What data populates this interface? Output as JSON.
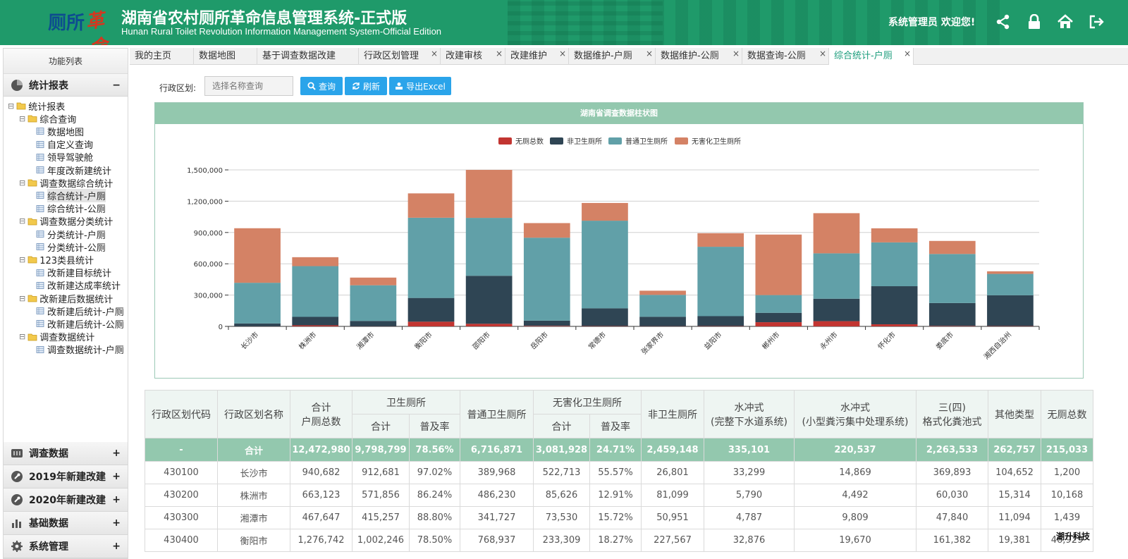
{
  "header": {
    "logo_text": "厕所",
    "logo_stylized": "革命",
    "title_cn": "湖南省农村厕所革命信息管理系统-正式版",
    "title_en": "Hunan Rural Toilet Revolution Information Management System-Official Edition",
    "welcome": "系统管理员 欢迎您!",
    "icons": [
      "share-icon",
      "lock-icon",
      "home-icon",
      "logout-icon"
    ]
  },
  "sidebar": {
    "title": "功能列表",
    "top_group": {
      "label": "统计报表",
      "sign": "−",
      "icon": "pie-chart-icon"
    },
    "tree": [
      {
        "label": "统计报表",
        "level": 0,
        "type": "folder",
        "toggle": "⊟"
      },
      {
        "label": "综合查询",
        "level": 1,
        "type": "folder",
        "toggle": "⊟"
      },
      {
        "label": "数据地图",
        "level": 2,
        "type": "page"
      },
      {
        "label": "自定义查询",
        "level": 2,
        "type": "page"
      },
      {
        "label": "领导驾驶舱",
        "level": 2,
        "type": "page"
      },
      {
        "label": "年度改新建统计",
        "level": 2,
        "type": "page"
      },
      {
        "label": "调查数据综合统计",
        "level": 1,
        "type": "folder",
        "toggle": "⊟"
      },
      {
        "label": "综合统计-户厕",
        "level": 2,
        "type": "page",
        "selected": true
      },
      {
        "label": "综合统计-公厕",
        "level": 2,
        "type": "page"
      },
      {
        "label": "调查数据分类统计",
        "level": 1,
        "type": "folder",
        "toggle": "⊟"
      },
      {
        "label": "分类统计-户厕",
        "level": 2,
        "type": "page"
      },
      {
        "label": "分类统计-公厕",
        "level": 2,
        "type": "page"
      },
      {
        "label": "123类县统计",
        "level": 1,
        "type": "folder",
        "toggle": "⊟"
      },
      {
        "label": "改新建目标统计",
        "level": 2,
        "type": "page"
      },
      {
        "label": "改新建达成率统计",
        "level": 2,
        "type": "page"
      },
      {
        "label": "改新建后数据统计",
        "level": 1,
        "type": "folder",
        "toggle": "⊟"
      },
      {
        "label": "改新建后统计-户厕",
        "level": 2,
        "type": "page"
      },
      {
        "label": "改新建后统计-公厕",
        "level": 2,
        "type": "page"
      },
      {
        "label": "调查数据统计",
        "level": 1,
        "type": "folder",
        "toggle": "⊟"
      },
      {
        "label": "调查数据统计-户厕",
        "level": 2,
        "type": "page"
      }
    ],
    "bottom_groups": [
      {
        "label": "调查数据",
        "sign": "+",
        "icon": "survey-icon"
      },
      {
        "label": "2019年新建改建",
        "sign": "+",
        "icon": "wrench-icon"
      },
      {
        "label": "2020年新建改建",
        "sign": "+",
        "icon": "wrench-icon"
      },
      {
        "label": "基础数据",
        "sign": "+",
        "icon": "bar-chart-icon"
      },
      {
        "label": "系统管理",
        "sign": "+",
        "icon": "gear-icon"
      }
    ]
  },
  "tabs": [
    {
      "label": "我的主页",
      "closable": false
    },
    {
      "label": "数据地图",
      "closable": false
    },
    {
      "label": "基于调查数据改建",
      "closable": false
    },
    {
      "label": "行政区划管理",
      "closable": true
    },
    {
      "label": "改建审核",
      "closable": true
    },
    {
      "label": "改建维护",
      "closable": true
    },
    {
      "label": "数据维护-户厕",
      "closable": true
    },
    {
      "label": "数据维护-公厕",
      "closable": true
    },
    {
      "label": "数据查询-公厕",
      "closable": true
    },
    {
      "label": "综合统计-户厕",
      "closable": true,
      "active": true
    }
  ],
  "search": {
    "label": "行政区划:",
    "placeholder": "选择名称查询",
    "query_label": "查询",
    "refresh_label": "刷新",
    "export_label": "导出Excel"
  },
  "chart_data": {
    "type": "bar",
    "stacked": true,
    "title": "湖南省调查数据柱状图",
    "legend_position": "top-center",
    "categories": [
      "长沙市",
      "株洲市",
      "湘潭市",
      "衡阳市",
      "邵阳市",
      "岳阳市",
      "常德市",
      "张家界市",
      "益阳市",
      "郴州市",
      "永州市",
      "怀化市",
      "娄底市",
      "湘西自治州"
    ],
    "series": [
      {
        "name": "无厕总数",
        "color": "#c23531",
        "values": [
          1200,
          10168,
          1439,
          45000,
          25000,
          5000,
          3000,
          2000,
          3000,
          40000,
          50000,
          20000,
          4000,
          3000
        ]
      },
      {
        "name": "非卫生厕所",
        "color": "#2f4554",
        "values": [
          26801,
          81099,
          50951,
          227567,
          460000,
          50000,
          170000,
          90000,
          95000,
          90000,
          215000,
          365000,
          220000,
          295000
        ]
      },
      {
        "name": "普通卫生厕所",
        "color": "#61a0a8",
        "values": [
          389968,
          486230,
          341727,
          768937,
          555000,
          795000,
          840000,
          210000,
          665000,
          170000,
          435000,
          420000,
          470000,
          205000
        ]
      },
      {
        "name": "无害化卫生厕所",
        "color": "#d48265",
        "values": [
          522713,
          85626,
          73530,
          233309,
          460000,
          140000,
          170000,
          40000,
          130000,
          580000,
          385000,
          135000,
          125000,
          25000
        ]
      }
    ],
    "ylim": [
      0,
      1500000
    ],
    "yticks": [
      "0",
      "300,000",
      "600,000",
      "900,000",
      "1,200,000",
      "1,500,000"
    ],
    "grid": "horizontal"
  },
  "table": {
    "headers": {
      "code": "行政区划代码",
      "name": "行政区划名称",
      "total_line1": "合计",
      "total_line2": "户厕总数",
      "sanitary": "卫生厕所",
      "sanitary_total": "合计",
      "sanitary_rate": "普及率",
      "ordinary": "普通卫生厕所",
      "harmless": "无害化卫生厕所",
      "harmless_total": "合计",
      "harmless_rate": "普及率",
      "non_sanitary": "非卫生厕所",
      "flush_a_line1": "水冲式",
      "flush_a_line2": "(完整下水道系统)",
      "flush_b_line1": "水冲式",
      "flush_b_line2": "(小型粪污集中处理系统)",
      "three_line1": "三(四)",
      "three_line2": "格式化粪池式",
      "other": "其他类型",
      "no_toilet": "无厕总数"
    },
    "rows": [
      [
        "-",
        "合计",
        "12,472,980",
        "9,798,799",
        "78.56%",
        "6,716,871",
        "3,081,928",
        "24.71%",
        "2,459,148",
        "335,101",
        "220,537",
        "2,263,533",
        "262,757",
        "215,033"
      ],
      [
        "430100",
        "长沙市",
        "940,682",
        "912,681",
        "97.02%",
        "389,968",
        "522,713",
        "55.57%",
        "26,801",
        "33,299",
        "14,869",
        "369,893",
        "104,652",
        "1,200"
      ],
      [
        "430200",
        "株洲市",
        "663,123",
        "571,856",
        "86.24%",
        "486,230",
        "85,626",
        "12.91%",
        "81,099",
        "5,790",
        "4,492",
        "60,030",
        "15,314",
        "10,168"
      ],
      [
        "430300",
        "湘潭市",
        "467,647",
        "415,257",
        "88.80%",
        "341,727",
        "73,530",
        "15.72%",
        "50,951",
        "4,787",
        "9,809",
        "47,840",
        "11,094",
        "1,439"
      ],
      [
        "430400",
        "衡阳市",
        "1,276,742",
        "1,002,246",
        "78.50%",
        "768,937",
        "233,309",
        "18.27%",
        "227,567",
        "32,876",
        "19,670",
        "161,382",
        "19,381",
        "46,929"
      ]
    ]
  },
  "watermark": "潮升科技"
}
